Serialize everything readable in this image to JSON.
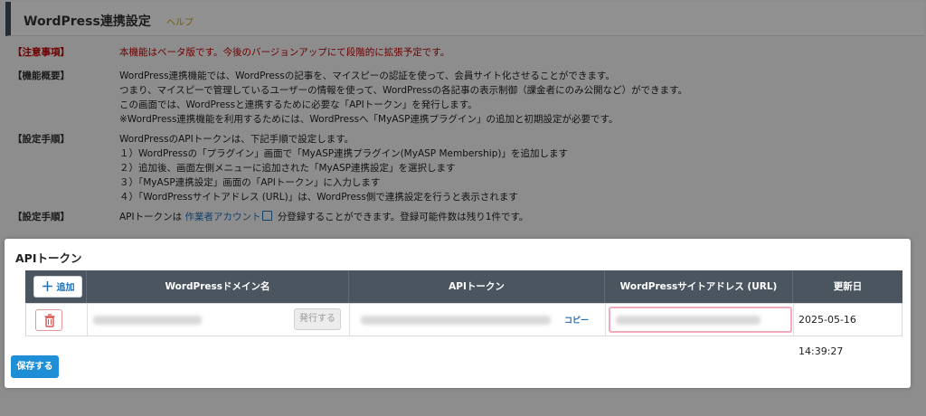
{
  "header": {
    "title": "WordPress連携設定",
    "help": "ヘルプ"
  },
  "info": {
    "notice_label": "【注意事項】",
    "notice_text": "本機能はベータ版です。今後のバージョンアップにて段階的に拡張予定です。",
    "overview_label": "【機能概要】",
    "overview_lines": [
      "WordPress連携機能では、WordPressの記事を、マイスピーの認証を使って、会員サイト化させることができます。",
      "つまり、マイスピーで管理しているユーザーの情報を使って、WordPressの各記事の表示制御（課金者にのみ公開など）ができます。",
      "この画面では、WordPressと連携するために必要な「APIトークン」を発行します。",
      "※WordPress連携機能を利用するためには、WordPressへ「MyASP連携プラグイン」の追加と初期設定が必要です。"
    ],
    "steps_label": "【設定手順】",
    "steps_lines": [
      "WordPressのAPIトークンは、下記手順で設定します。",
      "１）WordPressの「プラグイン」画面で「MyASP連携プラグイン(MyASP Membership)」を追加します",
      "２）追加後、画面左側メニューに追加された「MyASP連携設定」を選択します",
      "３）「MyASP連携設定」画面の「APIトークン」に入力します",
      "４）「WordPressサイトアドレス (URL)」は、WordPress側で連携設定を行うと表示されます"
    ],
    "steps2_label": "【設定手順】",
    "steps2_pre": "APIトークンは",
    "steps2_link": "作業者アカウント",
    "steps2_post": "分登録することができます。登録可能件数は残り1件です。"
  },
  "panel": {
    "title": "APIトークン",
    "add_label": "追加",
    "columns": [
      "WordPressドメイン名",
      "APIトークン",
      "WordPressサイトアドレス (URL)",
      "更新日"
    ],
    "row": {
      "issue_label": "発行する",
      "copy_label": "コピー",
      "updated": "2025-05-16 14:39:27"
    },
    "save_label": "保存する"
  },
  "colors": {
    "header_bg": "#4a5560",
    "accent": "#1e8fd6",
    "warn": "#c00000",
    "url_highlight": "#f4aabd"
  },
  "icons": {
    "add": "plus-icon",
    "delete": "trash-icon",
    "external": "external-link-icon"
  }
}
